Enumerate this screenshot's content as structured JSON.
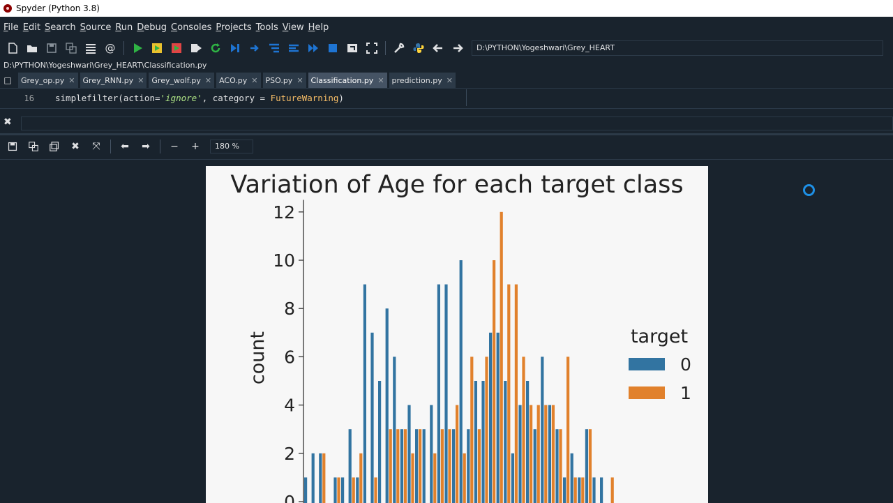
{
  "window": {
    "title": "Spyder (Python 3.8)"
  },
  "menu": [
    "File",
    "Edit",
    "Search",
    "Source",
    "Run",
    "Debug",
    "Consoles",
    "Projects",
    "Tools",
    "View",
    "Help"
  ],
  "toolbar": {
    "path": "D:\\PYTHON\\Yogeshwari\\Grey_HEART"
  },
  "editor": {
    "file_path": "D:\\PYTHON\\Yogeshwari\\Grey_HEART\\Classification.py",
    "tabs": [
      {
        "label": "Grey_op.py",
        "active": false
      },
      {
        "label": "Grey_RNN.py",
        "active": false
      },
      {
        "label": "Grey_wolf.py",
        "active": false
      },
      {
        "label": "ACO.py",
        "active": false
      },
      {
        "label": "PSO.py",
        "active": false
      },
      {
        "label": "Classification.py",
        "active": true
      },
      {
        "label": "prediction.py",
        "active": false
      }
    ],
    "line_number": "16",
    "code": {
      "pre": "simplefilter(action=",
      "str": "'ignore'",
      "mid": ", category = ",
      "cls": "FutureWarning",
      "post": ")"
    }
  },
  "plots_pane": {
    "zoom": "180 %"
  },
  "chart_data": {
    "type": "bar",
    "title": "Variation of Age for each target class",
    "xlabel": "",
    "ylabel": "count",
    "ylim": [
      0,
      12.5
    ],
    "yticks": [
      "0",
      "2",
      "4",
      "6",
      "8",
      "10",
      "12"
    ],
    "legend": {
      "title": "target",
      "placement": "right"
    },
    "series": [
      {
        "name": "0",
        "color": "#3274a1",
        "values": [
          1,
          2,
          2,
          0,
          1,
          1,
          3,
          1,
          9,
          7,
          5,
          8,
          6,
          3,
          4,
          3,
          3,
          4,
          9,
          9,
          3,
          10,
          3,
          5,
          5,
          7,
          7,
          5,
          2,
          4,
          5,
          3,
          6,
          4,
          3,
          1,
          2,
          1,
          3,
          1,
          1
        ]
      },
      {
        "name": "1",
        "color": "#e1812c",
        "values": [
          0,
          0,
          2,
          0,
          1,
          0,
          1,
          2,
          0,
          1,
          0,
          3,
          3,
          3,
          2,
          3,
          0,
          2,
          3,
          3,
          4,
          2,
          6,
          3,
          6,
          10,
          12,
          9,
          9,
          6,
          4,
          4,
          4,
          4,
          3,
          6,
          1,
          1,
          3,
          0,
          0,
          1
        ]
      }
    ]
  }
}
